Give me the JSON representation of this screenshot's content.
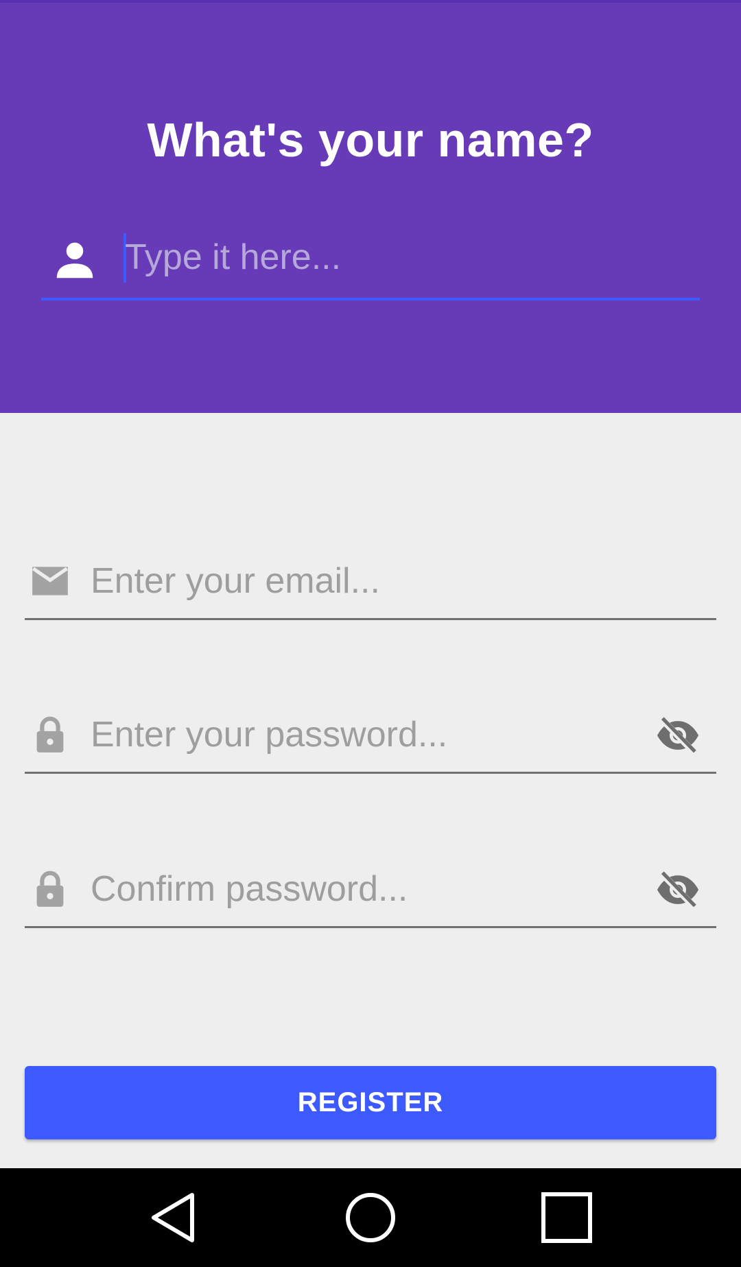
{
  "header": {
    "title": "What's your name?",
    "background_color": "#673ab7",
    "name_input": {
      "placeholder": "Type it here...",
      "value": "",
      "icon": "person-icon",
      "underline_color": "#3d5afe"
    }
  },
  "form": {
    "email": {
      "placeholder": "Enter your email...",
      "value": "",
      "icon": "email-icon"
    },
    "password": {
      "placeholder": "Enter your password...",
      "value": "",
      "icon": "lock-icon",
      "toggle_icon": "visibility-off-icon"
    },
    "confirm_password": {
      "placeholder": "Confirm password...",
      "value": "",
      "icon": "lock-icon",
      "toggle_icon": "visibility-off-icon"
    }
  },
  "register_button": {
    "label": "REGISTER",
    "color": "#3d5afe"
  },
  "navigation_bar": {
    "buttons": [
      "back-icon",
      "home-icon",
      "recent-apps-icon"
    ]
  }
}
